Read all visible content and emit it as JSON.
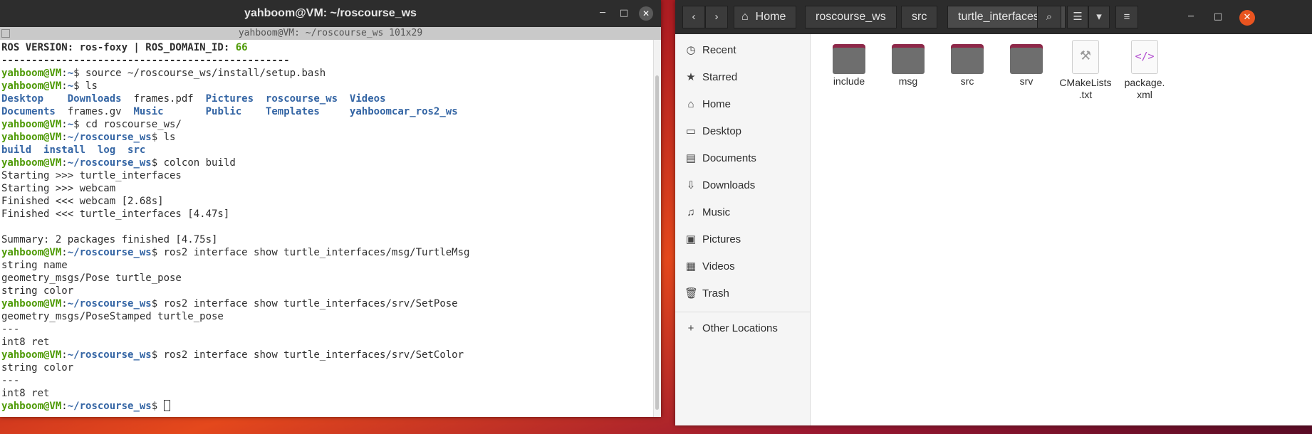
{
  "terminal": {
    "title": "yahboom@VM: ~/roscourse_ws",
    "subtitle": "yahboom@VM: ~/roscourse_ws 101x29",
    "controls": {
      "minimize": "─",
      "maximize": "□",
      "close": "✕"
    },
    "lines": [
      {
        "segs": [
          {
            "t": "ROS VERSION: ros-foxy | ROS_DOMAIN_ID: ",
            "c": "bold"
          },
          {
            "t": "66",
            "c": "grn"
          }
        ]
      },
      {
        "segs": [
          {
            "t": "------------------------------------------------",
            "c": "bold"
          }
        ]
      },
      {
        "segs": [
          {
            "t": "yahboom@VM",
            "c": "g"
          },
          {
            "t": ":",
            "c": ""
          },
          {
            "t": "~",
            "c": "b"
          },
          {
            "t": "$ source ~/roscourse_ws/install/setup.bash",
            "c": ""
          }
        ]
      },
      {
        "segs": [
          {
            "t": "yahboom@VM",
            "c": "g"
          },
          {
            "t": ":",
            "c": ""
          },
          {
            "t": "~",
            "c": "b"
          },
          {
            "t": "$ ls",
            "c": ""
          }
        ]
      },
      {
        "segs": [
          {
            "t": "Desktop",
            "c": "blue"
          },
          {
            "t": "    ",
            "c": ""
          },
          {
            "t": "Downloads",
            "c": "blue"
          },
          {
            "t": "  frames.pdf  ",
            "c": ""
          },
          {
            "t": "Pictures",
            "c": "blue"
          },
          {
            "t": "  ",
            "c": ""
          },
          {
            "t": "roscourse_ws",
            "c": "blue"
          },
          {
            "t": "  ",
            "c": ""
          },
          {
            "t": "Videos",
            "c": "blue"
          }
        ]
      },
      {
        "segs": [
          {
            "t": "Documents",
            "c": "blue"
          },
          {
            "t": "  frames.gv  ",
            "c": ""
          },
          {
            "t": "Music",
            "c": "blue"
          },
          {
            "t": "       ",
            "c": ""
          },
          {
            "t": "Public",
            "c": "blue"
          },
          {
            "t": "    ",
            "c": ""
          },
          {
            "t": "Templates",
            "c": "blue"
          },
          {
            "t": "     ",
            "c": ""
          },
          {
            "t": "yahboomcar_ros2_ws",
            "c": "blue"
          }
        ]
      },
      {
        "segs": [
          {
            "t": "yahboom@VM",
            "c": "g"
          },
          {
            "t": ":",
            "c": ""
          },
          {
            "t": "~",
            "c": "b"
          },
          {
            "t": "$ cd roscourse_ws/",
            "c": ""
          }
        ]
      },
      {
        "segs": [
          {
            "t": "yahboom@VM",
            "c": "g"
          },
          {
            "t": ":",
            "c": ""
          },
          {
            "t": "~/roscourse_ws",
            "c": "b"
          },
          {
            "t": "$ ls",
            "c": ""
          }
        ]
      },
      {
        "segs": [
          {
            "t": "build",
            "c": "blue"
          },
          {
            "t": "  ",
            "c": ""
          },
          {
            "t": "install",
            "c": "blue"
          },
          {
            "t": "  ",
            "c": ""
          },
          {
            "t": "log",
            "c": "blue"
          },
          {
            "t": "  ",
            "c": ""
          },
          {
            "t": "src",
            "c": "blue"
          }
        ]
      },
      {
        "segs": [
          {
            "t": "yahboom@VM",
            "c": "g"
          },
          {
            "t": ":",
            "c": ""
          },
          {
            "t": "~/roscourse_ws",
            "c": "b"
          },
          {
            "t": "$ colcon build",
            "c": ""
          }
        ]
      },
      {
        "segs": [
          {
            "t": "Starting >>> turtle_interfaces",
            "c": ""
          }
        ]
      },
      {
        "segs": [
          {
            "t": "Starting >>> webcam",
            "c": ""
          }
        ]
      },
      {
        "segs": [
          {
            "t": "Finished <<< webcam [2.68s]",
            "c": ""
          }
        ]
      },
      {
        "segs": [
          {
            "t": "Finished <<< turtle_interfaces [4.47s]",
            "c": ""
          }
        ]
      },
      {
        "segs": [
          {
            "t": "",
            "c": ""
          }
        ]
      },
      {
        "segs": [
          {
            "t": "Summary: 2 packages finished [4.75s]",
            "c": ""
          }
        ]
      },
      {
        "segs": [
          {
            "t": "yahboom@VM",
            "c": "g"
          },
          {
            "t": ":",
            "c": ""
          },
          {
            "t": "~/roscourse_ws",
            "c": "b"
          },
          {
            "t": "$ ros2 interface show turtle_interfaces/msg/TurtleMsg",
            "c": ""
          }
        ]
      },
      {
        "segs": [
          {
            "t": "string name",
            "c": ""
          }
        ]
      },
      {
        "segs": [
          {
            "t": "geometry_msgs/Pose turtle_pose",
            "c": ""
          }
        ]
      },
      {
        "segs": [
          {
            "t": "string color",
            "c": ""
          }
        ]
      },
      {
        "segs": [
          {
            "t": "yahboom@VM",
            "c": "g"
          },
          {
            "t": ":",
            "c": ""
          },
          {
            "t": "~/roscourse_ws",
            "c": "b"
          },
          {
            "t": "$ ros2 interface show turtle_interfaces/srv/SetPose",
            "c": ""
          }
        ]
      },
      {
        "segs": [
          {
            "t": "geometry_msgs/PoseStamped turtle_pose",
            "c": ""
          }
        ]
      },
      {
        "segs": [
          {
            "t": "---",
            "c": ""
          }
        ]
      },
      {
        "segs": [
          {
            "t": "int8 ret",
            "c": ""
          }
        ]
      },
      {
        "segs": [
          {
            "t": "yahboom@VM",
            "c": "g"
          },
          {
            "t": ":",
            "c": ""
          },
          {
            "t": "~/roscourse_ws",
            "c": "b"
          },
          {
            "t": "$ ros2 interface show turtle_interfaces/srv/SetColor",
            "c": ""
          }
        ]
      },
      {
        "segs": [
          {
            "t": "string color",
            "c": ""
          }
        ]
      },
      {
        "segs": [
          {
            "t": "---",
            "c": ""
          }
        ]
      },
      {
        "segs": [
          {
            "t": "int8 ret",
            "c": ""
          }
        ]
      },
      {
        "segs": [
          {
            "t": "yahboom@VM",
            "c": "g"
          },
          {
            "t": ":",
            "c": ""
          },
          {
            "t": "~/roscourse_ws",
            "c": "b"
          },
          {
            "t": "$ ",
            "c": ""
          }
        ],
        "cursor": true
      }
    ]
  },
  "files": {
    "nav": {
      "back": "‹",
      "forward": "›"
    },
    "breadcrumb": [
      "Home",
      "roscourse_ws",
      "src",
      "turtle_interfaces"
    ],
    "home_icon": "⌂",
    "dropdown_icon": "▾",
    "search_icon": "⌕",
    "view_icon": "☰",
    "view_dropdown_icon": "▾",
    "menu_icon": "≡",
    "controls": {
      "minimize": "─",
      "maximize": "□",
      "close": "✕"
    },
    "sidebar": [
      {
        "icon": "◷",
        "label": "Recent",
        "name": "recent"
      },
      {
        "icon": "★",
        "label": "Starred",
        "name": "starred"
      },
      {
        "icon": "⌂",
        "label": "Home",
        "name": "home"
      },
      {
        "icon": "▭",
        "label": "Desktop",
        "name": "desktop"
      },
      {
        "icon": "▤",
        "label": "Documents",
        "name": "documents"
      },
      {
        "icon": "⇩",
        "label": "Downloads",
        "name": "downloads"
      },
      {
        "icon": "♫",
        "label": "Music",
        "name": "music"
      },
      {
        "icon": "▣",
        "label": "Pictures",
        "name": "pictures"
      },
      {
        "icon": "▦",
        "label": "Videos",
        "name": "videos"
      },
      {
        "icon": "🗑",
        "label": "Trash",
        "name": "trash"
      }
    ],
    "other_locations": {
      "icon": "+",
      "label": "Other Locations"
    },
    "items": [
      {
        "type": "folder",
        "label": "include"
      },
      {
        "type": "folder",
        "label": "msg"
      },
      {
        "type": "folder",
        "label": "src"
      },
      {
        "type": "folder",
        "label": "srv"
      },
      {
        "type": "cmake",
        "label": "CMakeLists\n.txt",
        "glyph": "⚒"
      },
      {
        "type": "xml",
        "label": "package.\nxml",
        "glyph": "</>"
      }
    ]
  }
}
